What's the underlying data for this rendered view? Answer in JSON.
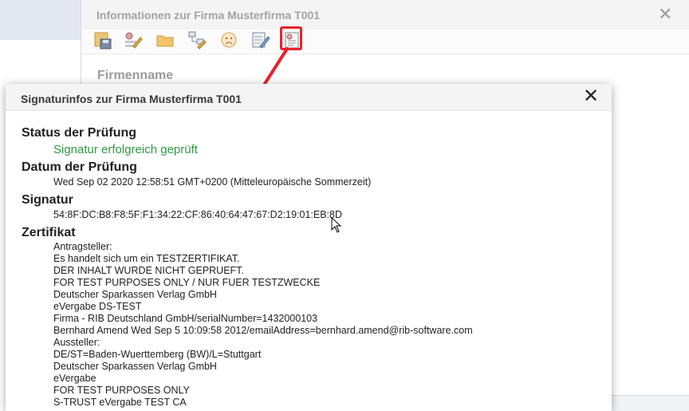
{
  "back_dialog": {
    "title": "Informationen zur Firma Musterfirma T001",
    "close_glyph": "✕",
    "field_label": "Firmenname",
    "toolbar_icons": [
      "save-icon",
      "edit-sign-icon",
      "folder-icon",
      "hierarchy-icon",
      "sad-face-icon",
      "checklist-icon",
      "signature-info-icon"
    ]
  },
  "front_dialog": {
    "title": "Signaturinfos zur Firma Musterfirma T001",
    "close_glyph": "✕",
    "status_title": "Status der Prüfung",
    "status_value": "Signatur erfolgreich geprüft",
    "date_title": "Datum der Prüfung",
    "date_value": "Wed Sep 02 2020 12:58:51 GMT+0200 (Mitteleuropäische Sommerzeit)",
    "signature_title": "Signatur",
    "signature_value": "54:8F:DC:B8:F8:5F:F1:34:22:CF:86:40:64:47:67:D2:19:01:EB:8D",
    "cert_title": "Zertifikat",
    "cert_lines": [
      "Antragsteller:",
      "Es handelt sich um ein TESTZERTIFIKAT.",
      "DER INHALT WURDE NICHT GEPRUEFT.",
      "FOR TEST PURPOSES ONLY / NUR FUER TESTZWECKE",
      "Deutscher Sparkassen Verlag GmbH",
      "eVergabe DS-TEST",
      "Firma - RIB Deutschland GmbH/serialNumber=1432000103",
      "Bernhard Amend Wed Sep 5 10:09:58 2012/emailAddress=bernhard.amend@rib-software.com",
      "Aussteller:",
      "DE/ST=Baden-Wuerttemberg (BW)/L=Stuttgart",
      "Deutscher Sparkassen Verlag GmbH",
      "eVergabe",
      "FOR TEST PURPOSES ONLY",
      "S-TRUST eVergabe TEST CA"
    ]
  },
  "colors": {
    "success": "#2d9a42",
    "highlight": "#e8212b"
  }
}
